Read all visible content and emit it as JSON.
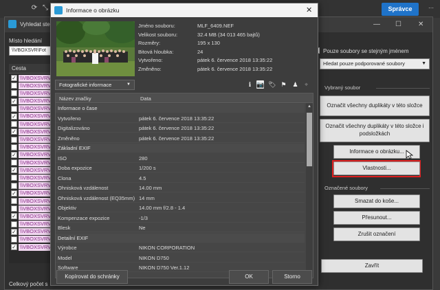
{
  "app": {
    "top_button": "Správce",
    "finder": {
      "title": "Vyhledat ste",
      "place_label": "Místo hledání",
      "place_value": "\\\\VBOXSVR\\Fot",
      "path_header": "Cesta",
      "rows": [
        {
          "checked": true,
          "path": "\\\\VBOXSVRV"
        },
        {
          "checked": false,
          "path": "\\\\VBOXSVRV"
        },
        {
          "checked": false,
          "path": "\\\\VBOXSVRV"
        },
        {
          "checked": true,
          "path": "\\\\VBOXSVRV"
        },
        {
          "checked": false,
          "path": "\\\\VBOXSVRV"
        },
        {
          "checked": true,
          "path": "\\\\VBOXSVRV"
        },
        {
          "checked": false,
          "path": "\\\\VBOXSVRV"
        },
        {
          "checked": true,
          "path": "\\\\VBOXSVRV"
        },
        {
          "checked": false,
          "path": "\\\\VBOXSVRV"
        },
        {
          "checked": false,
          "path": "\\\\VBOXSVRV"
        },
        {
          "checked": true,
          "path": "\\\\VBOXSVRV"
        },
        {
          "checked": false,
          "path": "\\\\VBOXSVRV"
        },
        {
          "checked": true,
          "path": "\\\\VBOXSVRV"
        },
        {
          "checked": false,
          "path": "\\\\VBOXSVRV"
        },
        {
          "checked": false,
          "path": "\\\\VBOXSVRV"
        },
        {
          "checked": true,
          "path": "\\\\VBOXSVRV"
        },
        {
          "checked": false,
          "path": "\\\\VBOXSVRV"
        },
        {
          "checked": false,
          "path": "\\\\VBOXSVRV"
        },
        {
          "checked": true,
          "path": "\\\\VBOXSVRV"
        },
        {
          "checked": false,
          "path": "\\\\VBOXSVRV"
        },
        {
          "checked": true,
          "path": "\\\\VBOXSVRV"
        },
        {
          "checked": false,
          "path": "\\\\VBOXSVRV"
        },
        {
          "checked": true,
          "path": "\\\\VBOXSVRV"
        }
      ],
      "count_label": "Celkový počet s",
      "right_panel": {
        "same_name_label": "Pouze soubory se stejným jménem",
        "filter_select": "Hledat pouze podporované soubory",
        "selected_file_section": "Vybraný soubor",
        "mark_dupes_folder": "Označit všechny duplikáty v této složce",
        "mark_dupes_subfolders_1": "Označit všechny duplikáty v této složce i",
        "mark_dupes_subfolders_2": "podsložkách",
        "image_info": "Informace o obrázku...",
        "properties": "Vlastnosti...",
        "marked_section": "Označené soubory",
        "delete_to_bin": "Smazat do koše...",
        "move": "Přesunout...",
        "cancel_marking": "Zrušit označení",
        "close": "Zavřít"
      }
    }
  },
  "dialog": {
    "title": "Informace o obrázku",
    "meta": [
      {
        "label": "Jméno souboru:",
        "value": "MLF_6409.NEF"
      },
      {
        "label": "Velikost souboru:",
        "value": "32.4 MB (34 013 465 bajtů)"
      },
      {
        "label": "Rozměry:",
        "value": "195 x 130"
      },
      {
        "label": "Bitová hloubka:",
        "value": "24"
      },
      {
        "label": "Vytvořeno:",
        "value": "pátek 6. července 2018 13:35:22"
      },
      {
        "label": "Změněno:",
        "value": "pátek 6. července 2018 13:35:22"
      }
    ],
    "info_select": "Fotografické informace",
    "table_headers": {
      "name": "Název značky",
      "data": "Data"
    },
    "rows": [
      {
        "group": true,
        "name": "Informace o čase",
        "value": ""
      },
      {
        "group": false,
        "name": "Vytvořeno",
        "value": "pátek 6. července 2018 13:35:22"
      },
      {
        "group": false,
        "name": "Digitalizováno",
        "value": "pátek 6. července 2018 13:35:22"
      },
      {
        "group": false,
        "name": "Změněno",
        "value": "pátek 6. července 2018 13:35:22"
      },
      {
        "group": true,
        "name": "Základní EXIF",
        "value": ""
      },
      {
        "group": false,
        "name": "ISO",
        "value": "280"
      },
      {
        "group": false,
        "name": "Doba expozice",
        "value": "1/200 s"
      },
      {
        "group": false,
        "name": "Clona",
        "value": "4.5"
      },
      {
        "group": false,
        "name": "Ohnisková vzdálenost",
        "value": "14.00 mm"
      },
      {
        "group": false,
        "name": "Ohnisková vzdálenost (EQ35mm)",
        "value": "14 mm"
      },
      {
        "group": false,
        "name": "Objektiv",
        "value": "14.00 mm f/2.8 - 1.4"
      },
      {
        "group": false,
        "name": "Kompenzace expozice",
        "value": "-1/3"
      },
      {
        "group": false,
        "name": "Blesk",
        "value": "Ne"
      },
      {
        "group": true,
        "name": "Detailní EXIF",
        "value": ""
      },
      {
        "group": false,
        "name": "Výrobce",
        "value": "NIKON CORPORATION"
      },
      {
        "group": false,
        "name": "Model",
        "value": "NIKON D750"
      },
      {
        "group": false,
        "name": "Software",
        "value": "NIKON D750 Ver.1.12"
      }
    ],
    "copy_button": "Kopírovat do schránky",
    "ok_button": "OK",
    "cancel_button": "Storno"
  }
}
